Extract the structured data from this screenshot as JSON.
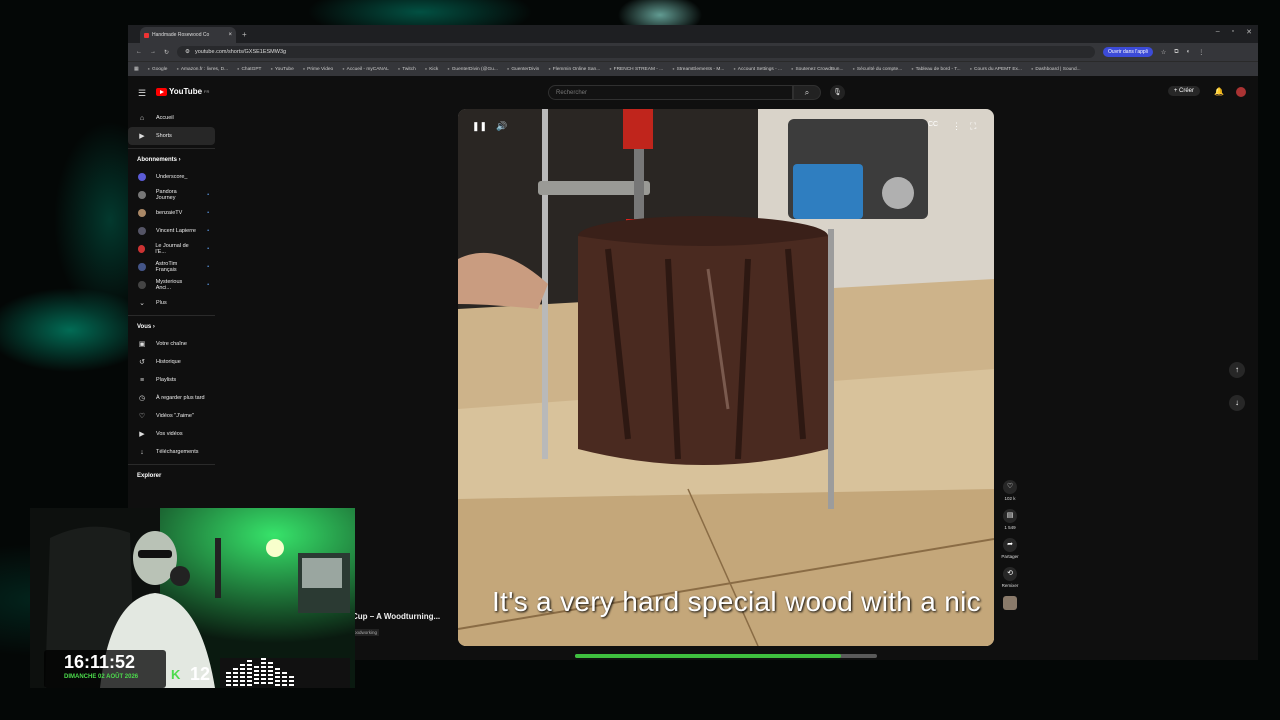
{
  "browser": {
    "tab_title": "Handmade Rosewood Co",
    "new_tab": "+",
    "url": "youtube.com/shorts/GXSE1ESMW3g",
    "open_app": "Ouvrir dans l'appli",
    "bookmarks": [
      "Google",
      "Amazon.fr : livres, D...",
      "ChatGPT",
      "YouTube",
      "Prime Video",
      "Accueil - myCANAL",
      "Twitch",
      "Kick",
      "GuenterDivin (@Gu...",
      "GuenterDivin",
      "Flemmin Online San...",
      "FRENCH STREAM - ...",
      "StreamElements - M...",
      "Account Settings - ...",
      "Soutenez CrowdBun...",
      "Sécurité du compte...",
      "Tableau de bord - T...",
      "Cours du APEMT Ex...",
      "Dashboard | Sound..."
    ]
  },
  "youtube": {
    "logo": "YouTube",
    "logo_region": "FR",
    "search_placeholder": "Rechercher",
    "create": "Créer"
  },
  "sidebar": {
    "main": [
      {
        "label": "Accueil",
        "icon": "home-icon"
      },
      {
        "label": "Shorts",
        "icon": "shorts-icon"
      }
    ],
    "subscriptions_title": "Abonnements",
    "subscriptions": [
      "Underscore_",
      "Pandora Journey",
      "benzaieTV",
      "Vincent Lapierre",
      "Le Journal de l'E...",
      "AstroTim Français",
      "Mysterious Anci..."
    ],
    "more": "Plus",
    "you_title": "Vous",
    "you": [
      "Votre chaîne",
      "Historique",
      "Playlists",
      "À regarder plus tard",
      "Vidéos \"J'aime\"",
      "Vos vidéos",
      "Téléchargements"
    ],
    "explore_title": "Explorer"
  },
  "video": {
    "caption": "It's a very hard special wood with a nic",
    "title": "Cup – A Woodturning...",
    "channel": "oodworking",
    "progress": 0.88
  },
  "actions": {
    "likes": "102 k",
    "comments": "1 549",
    "share": "Partager",
    "remix": "Remixer"
  },
  "overlay": {
    "time": "16:11:52",
    "date": "DIMANCHE 02 AOÛT 2026",
    "kick_logo": "K",
    "viewers": "12"
  }
}
